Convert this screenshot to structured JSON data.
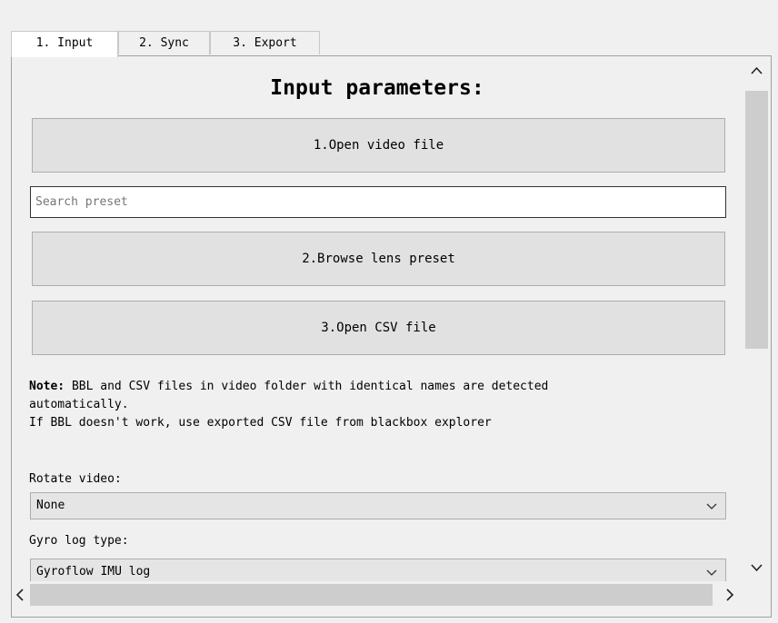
{
  "tabs": [
    {
      "label": "1. Input",
      "active": true
    },
    {
      "label": "2. Sync",
      "active": false
    },
    {
      "label": "3. Export",
      "active": false
    }
  ],
  "input_tab": {
    "heading": "Input parameters:",
    "open_video_label": "1.Open video file",
    "search_placeholder": "Search preset",
    "search_value": "",
    "browse_lens_label": "2.Browse lens preset",
    "open_csv_label": "3.Open CSV file",
    "note_bold": "Note:",
    "note_line1": " BBL and CSV files in video folder with identical names are detected",
    "note_line2": "automatically.",
    "note_line3": "If BBL doesn't work, use exported CSV file from blackbox explorer",
    "rotate_label": "Rotate video:",
    "rotate_value": "None",
    "gyro_label": "Gyro log type:",
    "gyro_value": "Gyroflow IMU log"
  },
  "icons": {
    "rotate_dropdown": "chevron-down-icon",
    "gyro_dropdown": "chevron-down-icon",
    "scroll_up": "scroll-up-arrow-icon",
    "scroll_down": "scroll-down-arrow-icon",
    "scroll_left": "scroll-left-arrow-icon",
    "scroll_right": "scroll-right-arrow-icon"
  },
  "scroll": {
    "vertical_position": 0,
    "horizontal_position": 0
  }
}
